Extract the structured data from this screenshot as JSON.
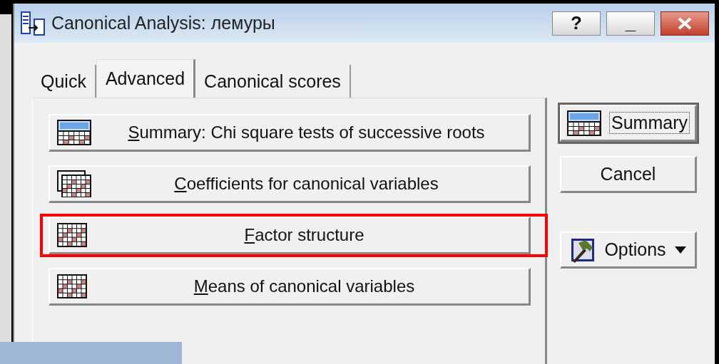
{
  "window": {
    "title": "Canonical Analysis: лемуры",
    "controls": [
      {
        "kind": "help",
        "label": "?"
      },
      {
        "kind": "minimize",
        "label": "_"
      },
      {
        "kind": "close"
      }
    ]
  },
  "tabs": [
    {
      "label": "Quick",
      "selected": false
    },
    {
      "label": "Advanced",
      "selected": true
    },
    {
      "label": "Canonical scores",
      "selected": false
    }
  ],
  "buttons": [
    {
      "label": "Summary:  Chi square tests of successive roots",
      "kind": "summary",
      "highlighted": false
    },
    {
      "label": "Coefficients for canonical variables",
      "kind": "stacked",
      "highlighted": false
    },
    {
      "label": "Factor structure",
      "kind": "grid",
      "highlighted": true
    },
    {
      "label": "Means of canonical variables",
      "kind": "grid",
      "highlighted": false
    }
  ],
  "side_buttons": [
    {
      "label": "Summary",
      "kind": "summary",
      "focused": true,
      "dropdown": false
    },
    {
      "label": "Cancel",
      "kind": "plain",
      "focused": false,
      "dropdown": false
    },
    {
      "label": "Options",
      "kind": "hammer",
      "focused": false,
      "dropdown": true
    }
  ]
}
